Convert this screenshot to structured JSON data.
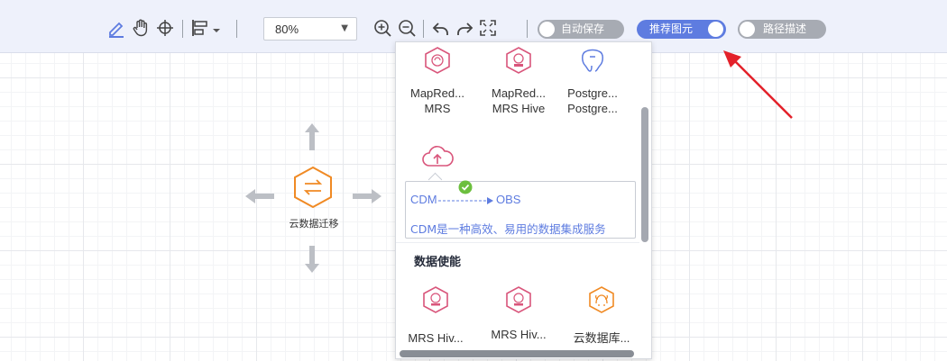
{
  "toolbar": {
    "zoom": "80%",
    "toggles": {
      "autosave": {
        "label": "自动保存",
        "on": false
      },
      "recommend": {
        "label": "推荐图元",
        "on": true
      },
      "path_desc": {
        "label": "路径描述",
        "on": false
      }
    },
    "icons": [
      "edit-icon",
      "hand-pan-icon",
      "crosshair-move-icon",
      "align-left-icon",
      "chevron-down-icon",
      "zoom-in-icon",
      "zoom-out-icon",
      "undo-icon",
      "redo-icon",
      "fit-screen-icon"
    ]
  },
  "canvas": {
    "node": {
      "label": "云数据迁移",
      "icon": "data-migration-icon"
    }
  },
  "palette": {
    "row1": [
      {
        "line1": "MapRed...",
        "line2": "MRS",
        "icon": "mapreduce-mrs-icon"
      },
      {
        "line1": "MapRed...",
        "line2": "MRS Hive",
        "icon": "mapreduce-hive-icon"
      },
      {
        "line1": "Postgre...",
        "line2": "Postgre...",
        "icon": "postgresql-icon"
      }
    ],
    "cdm_icon": "cloud-upload-icon",
    "tooltip": {
      "source": "CDM",
      "target": "OBS",
      "description": "CDM是一种高效、易用的数据集成服务"
    },
    "section_title": "数据使能",
    "row2": [
      {
        "line1": "MRS Hiv...",
        "icon": "mrs-hive-icon"
      },
      {
        "line1": "MRS Hiv...",
        "icon": "mrs-hive-icon-2"
      },
      {
        "line1": "云数据库...",
        "icon": "cloud-database-icon"
      }
    ]
  },
  "colors": {
    "accent": "#5e7ce0",
    "pink": "#d9557b",
    "orange": "#f08a24",
    "success": "#6cbf3e",
    "annotation_red": "#e3212a"
  }
}
